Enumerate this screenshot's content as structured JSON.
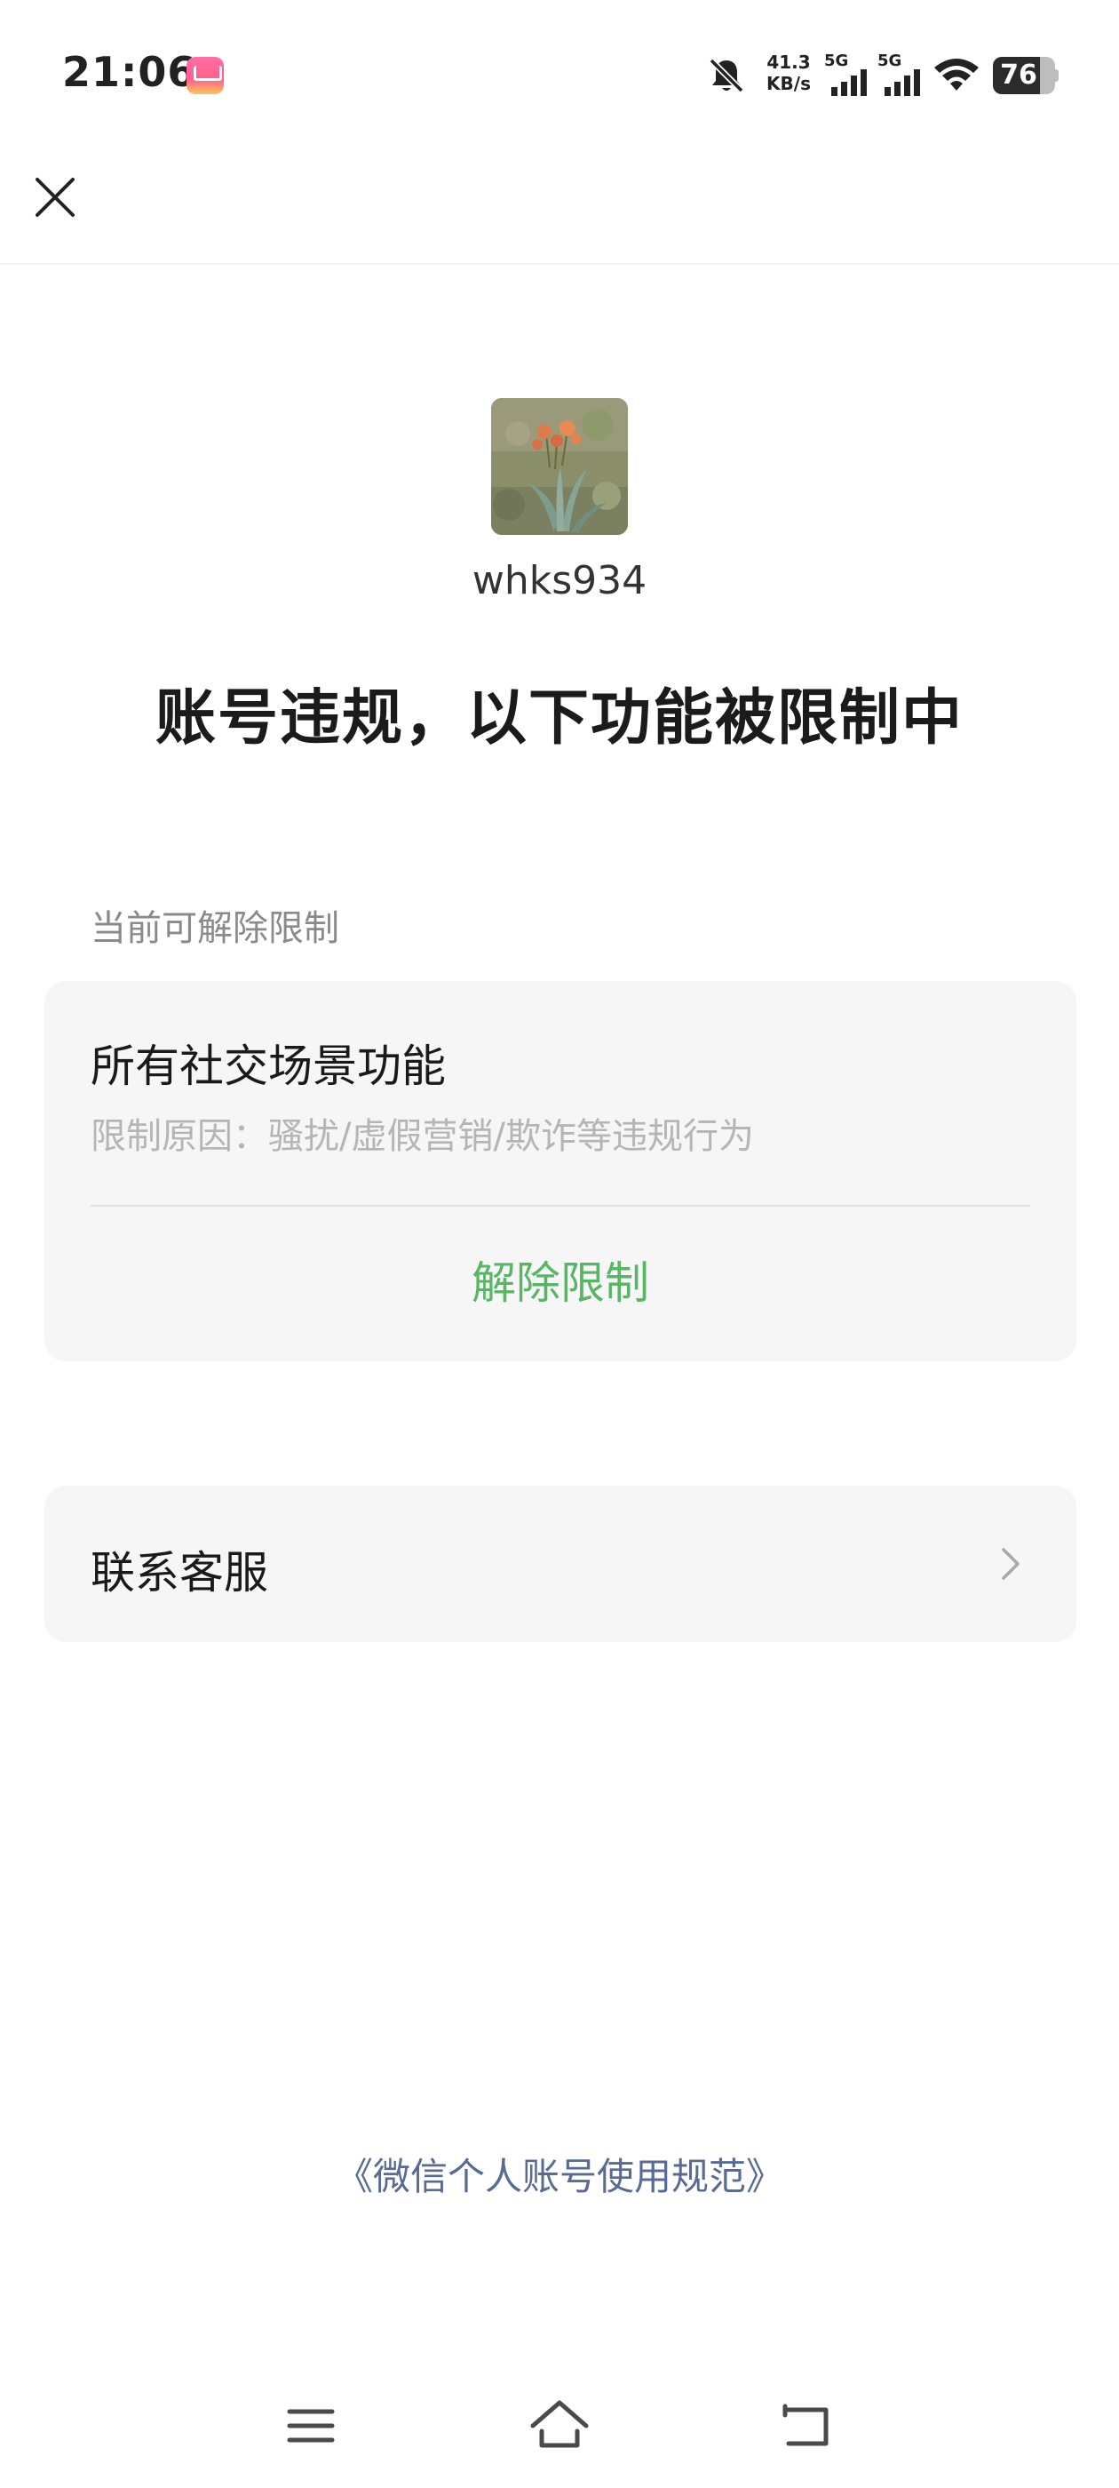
{
  "status_bar": {
    "time": "21:06",
    "net_speed_value": "41.3",
    "net_speed_unit": "KB/s",
    "sim1_label": "5G",
    "sim2_label": "5G",
    "battery_level": "76",
    "battery_fraction": 0.76,
    "icons": [
      "app-badge-icon",
      "bell-off-icon",
      "signal-icon",
      "wifi-icon",
      "battery-icon"
    ]
  },
  "nav": {
    "close_icon": "close-icon"
  },
  "profile": {
    "username": "whks934"
  },
  "headline": "账号违规，以下功能被限制中",
  "section": {
    "label": "当前可解除限制",
    "restriction": {
      "title": "所有社交场景功能",
      "reason": "限制原因：骚扰/虚假营销/欺诈等违规行为",
      "action_label": "解除限制"
    }
  },
  "service": {
    "label": "联系客服",
    "icon": "chevron-right-icon"
  },
  "policy_link": "《微信个人账号使用规范》",
  "system_nav": {
    "icons": [
      "menu-icon",
      "home-icon",
      "back-icon"
    ]
  },
  "colors": {
    "accent_green": "#58b566",
    "link_blue": "#576b95",
    "card_bg": "#f6f6f6"
  }
}
